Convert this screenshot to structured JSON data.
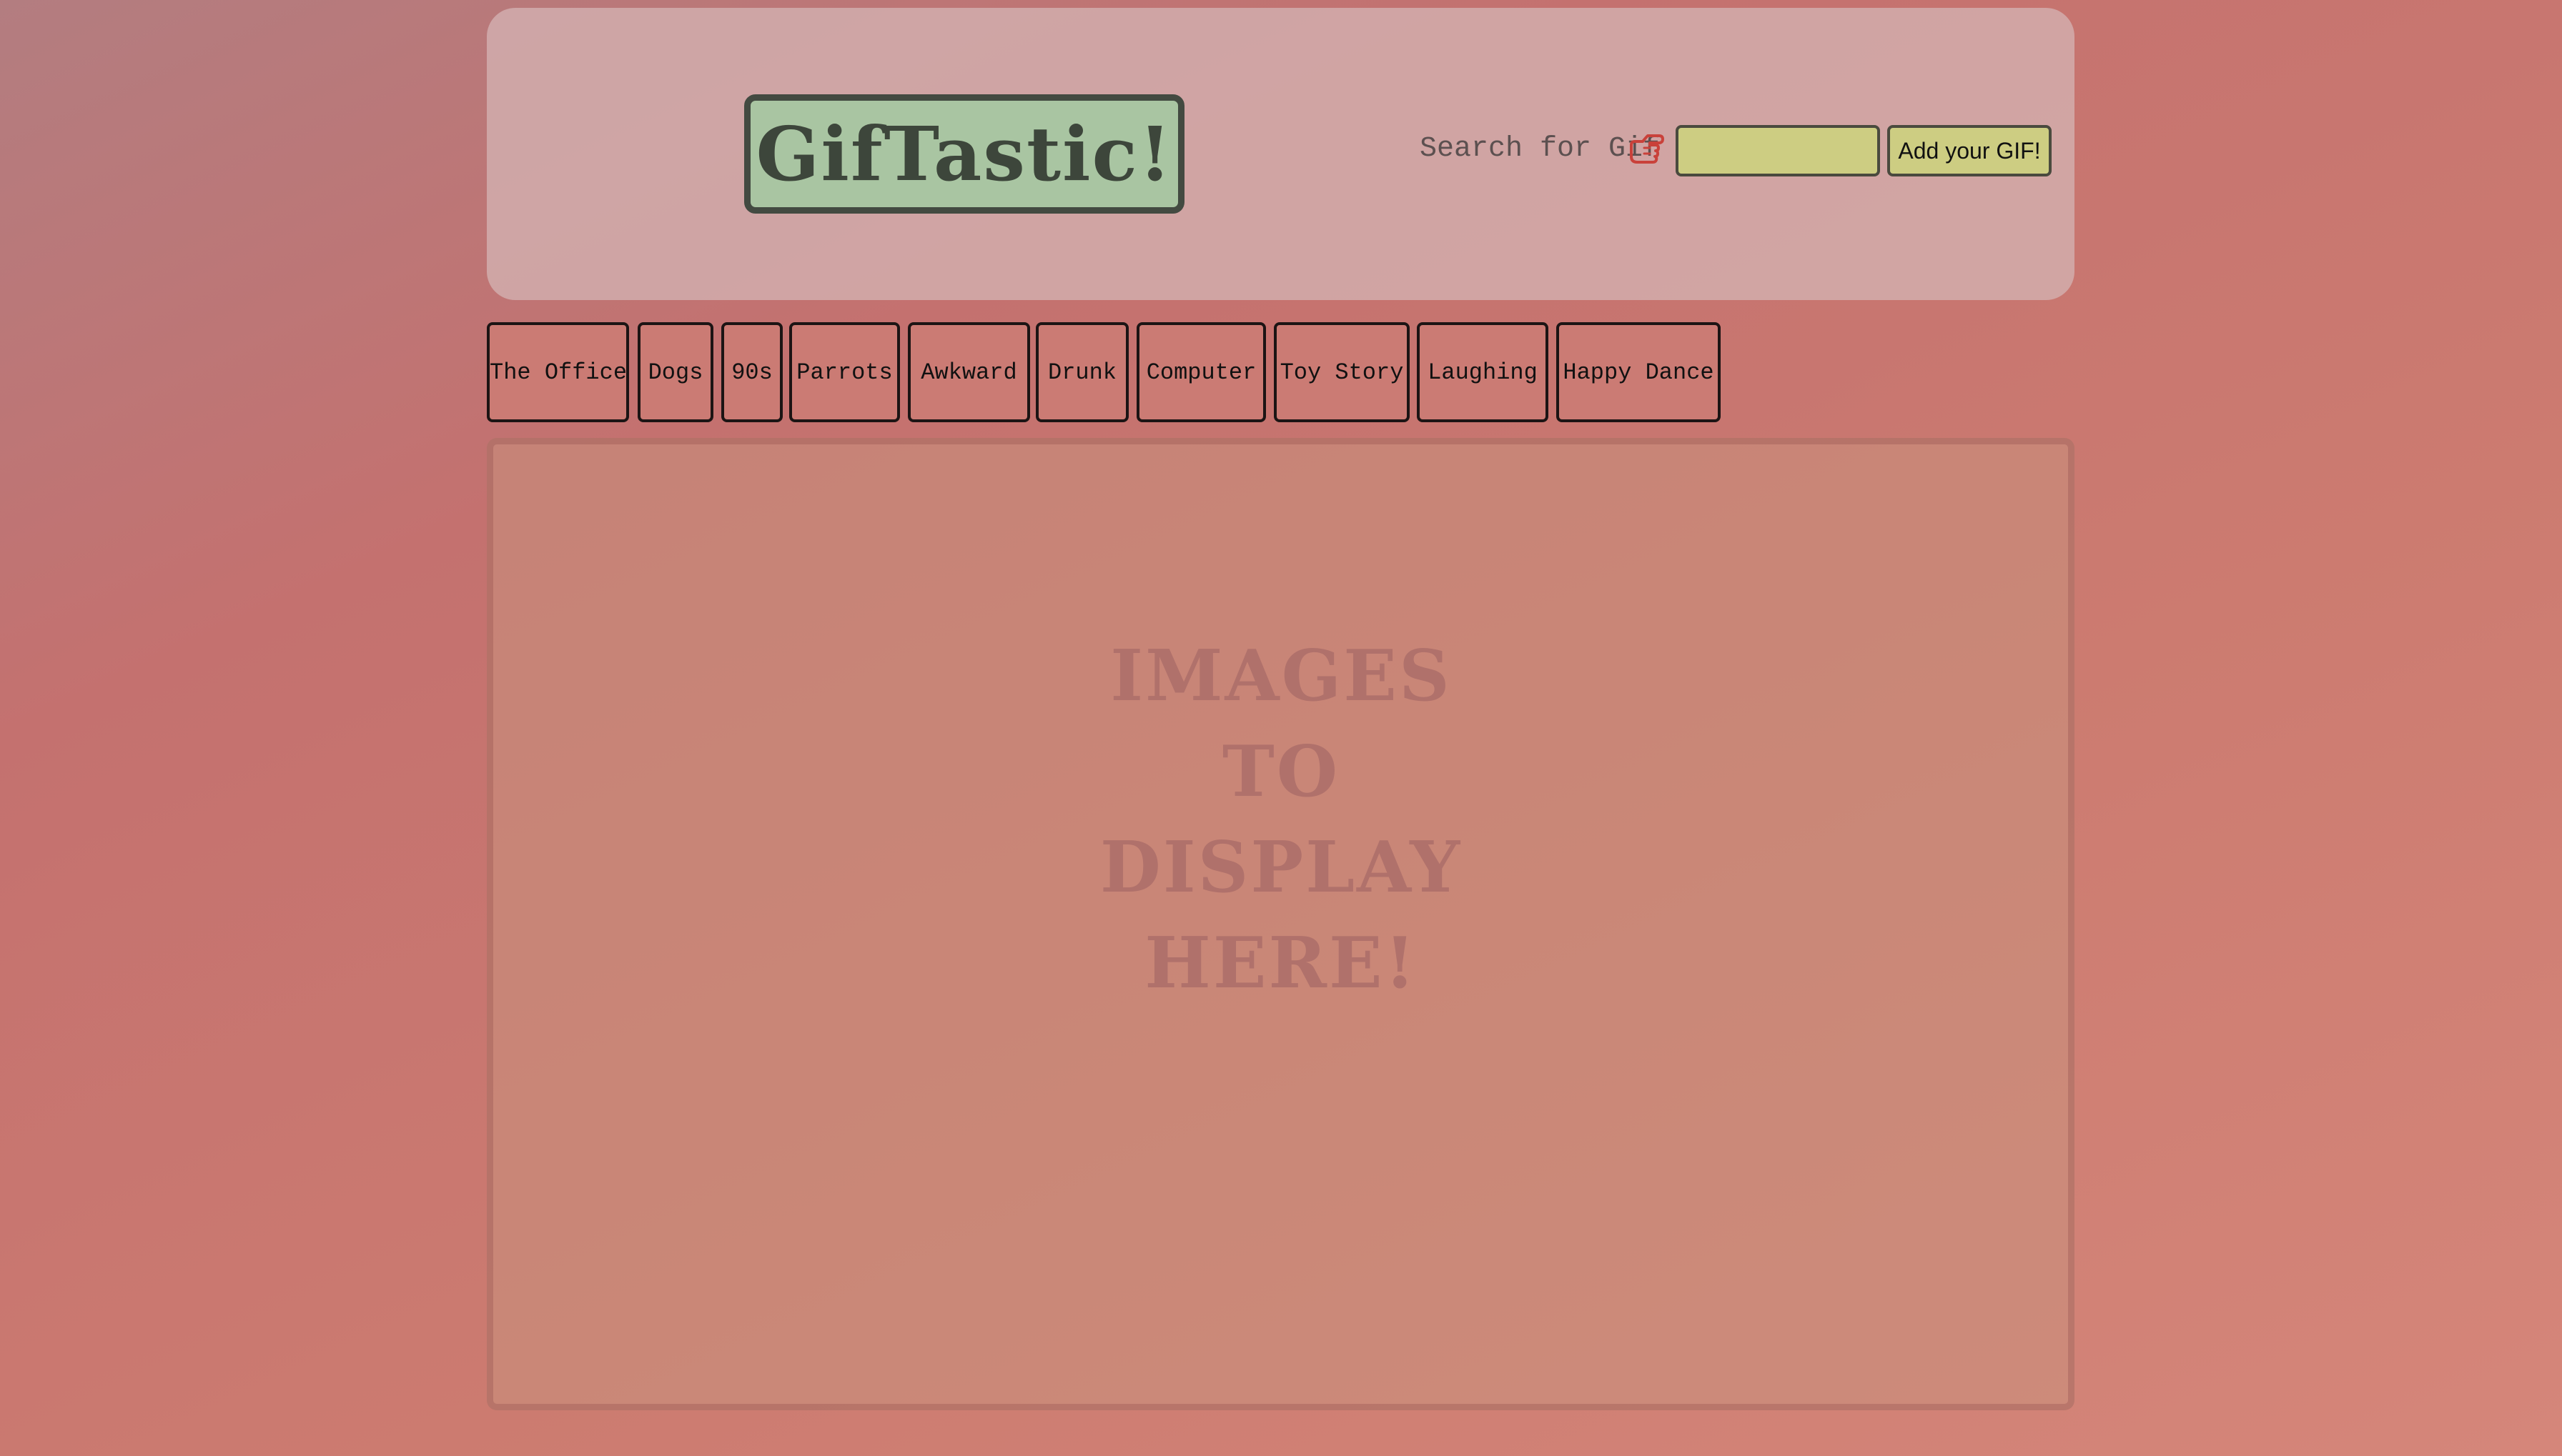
{
  "header": {
    "logo_text": "GifTastic!",
    "search_label": "Search for Gif",
    "hand_icon": "pointing-hand-icon",
    "search_input_value": "",
    "add_button_label": "Add your GIF!"
  },
  "topics": [
    "The Office",
    "Dogs",
    "90s",
    "Parrots",
    "Awkward",
    "Drunk",
    "Computer",
    "Toy Story",
    "Laughing",
    "Happy Dance"
  ],
  "display": {
    "placeholder_lines": [
      "IMAGES",
      "TO",
      "DISPLAY",
      "HERE!"
    ]
  },
  "colors": {
    "logo_bg": "#a9c5a2",
    "input_bg": "#cdcd82",
    "hand_icon": "#c9413a"
  }
}
